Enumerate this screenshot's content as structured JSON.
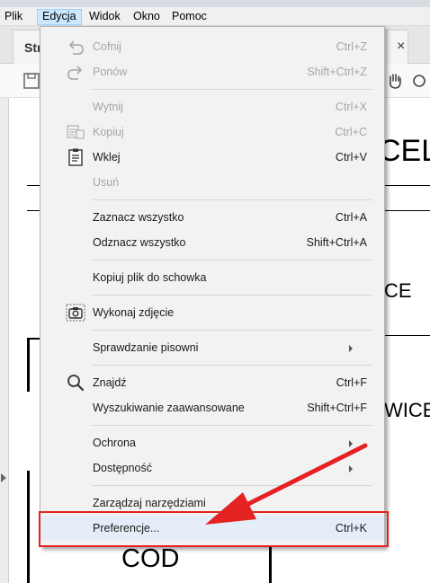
{
  "menubar": {
    "items": [
      "Plik",
      "Edycja",
      "Widok",
      "Okno",
      "Pomoc"
    ],
    "active": "Edycja"
  },
  "document_tab": {
    "label": "Str",
    "close": "×"
  },
  "document_text": [
    "CEL",
    "CE",
    "WICE",
    "COD"
  ],
  "menu": {
    "undo": {
      "label": "Cofnij",
      "shortcut": "Ctrl+Z"
    },
    "redo": {
      "label": "Ponów",
      "shortcut": "Shift+Ctrl+Z"
    },
    "cut": {
      "label": "Wytnij",
      "shortcut": "Ctrl+X"
    },
    "copy": {
      "label": "Kopiuj",
      "shortcut": "Ctrl+C"
    },
    "paste": {
      "label": "Wklej",
      "shortcut": "Ctrl+V"
    },
    "delete": {
      "label": "Usuń",
      "shortcut": ""
    },
    "select_all": {
      "label": "Zaznacz wszystko",
      "shortcut": "Ctrl+A"
    },
    "deselect_all": {
      "label": "Odznacz wszystko",
      "shortcut": "Shift+Ctrl+A"
    },
    "copy_file": {
      "label": "Kopiuj plik do schowka",
      "shortcut": ""
    },
    "snapshot": {
      "label": "Wykonaj zdjęcie",
      "shortcut": ""
    },
    "spellcheck": {
      "label": "Sprawdzanie pisowni",
      "shortcut": ""
    },
    "find": {
      "label": "Znajdź",
      "shortcut": "Ctrl+F"
    },
    "advanced_search": {
      "label": "Wyszukiwanie zaawansowane",
      "shortcut": "Shift+Ctrl+F"
    },
    "protection": {
      "label": "Ochrona",
      "shortcut": ""
    },
    "accessibility": {
      "label": "Dostępność",
      "shortcut": ""
    },
    "manage_tools": {
      "label": "Zarządzaj narzędziami",
      "shortcut": ""
    },
    "preferences": {
      "label": "Preferencje...",
      "shortcut": "Ctrl+K"
    }
  },
  "annotation": {
    "color": "#e52222",
    "highlighted_item": "Preferencje..."
  }
}
